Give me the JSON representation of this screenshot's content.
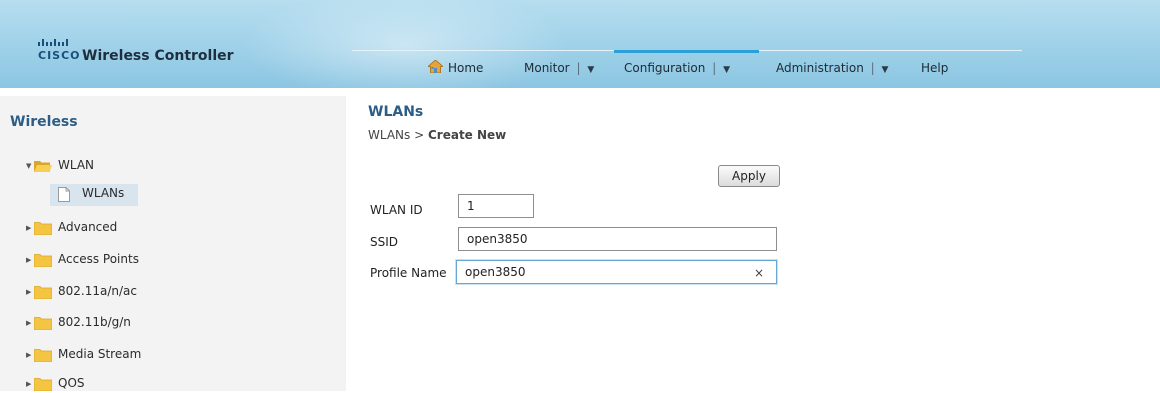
{
  "header": {
    "logo_text": "CISCO",
    "app_title": "Wireless Controller",
    "nav": [
      {
        "label": "Home",
        "has_dropdown": false
      },
      {
        "label": "Monitor",
        "has_dropdown": true
      },
      {
        "label": "Configuration",
        "has_dropdown": true,
        "active": true
      },
      {
        "label": "Administration",
        "has_dropdown": true
      },
      {
        "label": "Help",
        "has_dropdown": false
      }
    ],
    "separator": "|",
    "dropdown_glyph": "▼"
  },
  "sidebar": {
    "title": "Wireless",
    "tree": [
      {
        "label": "WLAN",
        "expanded": true,
        "icon": "folder-open-icon"
      },
      {
        "label": "WLANs",
        "selected": true,
        "icon": "document-icon"
      },
      {
        "label": "Advanced",
        "icon": "folder-icon"
      },
      {
        "label": "Access Points",
        "icon": "folder-icon"
      },
      {
        "label": "802.11a/n/ac",
        "icon": "folder-icon"
      },
      {
        "label": "802.11b/g/n",
        "icon": "folder-icon"
      },
      {
        "label": "Media Stream",
        "icon": "folder-icon"
      },
      {
        "label": "QOS",
        "icon": "folder-icon"
      }
    ]
  },
  "main": {
    "title": "WLANs",
    "breadcrumb": {
      "parent": "WLANs",
      "separator": ">",
      "current": "Create New"
    },
    "apply_label": "Apply",
    "form": {
      "wlan_id": {
        "label": "WLAN ID",
        "value": "1"
      },
      "ssid": {
        "label": "SSID",
        "value": "open3850"
      },
      "profile_name": {
        "label": "Profile Name",
        "value": "open3850",
        "clear_glyph": "×"
      }
    }
  },
  "colors": {
    "header_bg": "#a2d3ea",
    "active_tab_underline": "#2aa0d6",
    "title_blue": "#2b5d86",
    "folder_yellow": "#f4c542",
    "sidebar_bg": "#f3f3f3",
    "selected_bg": "#d8e4ee"
  }
}
